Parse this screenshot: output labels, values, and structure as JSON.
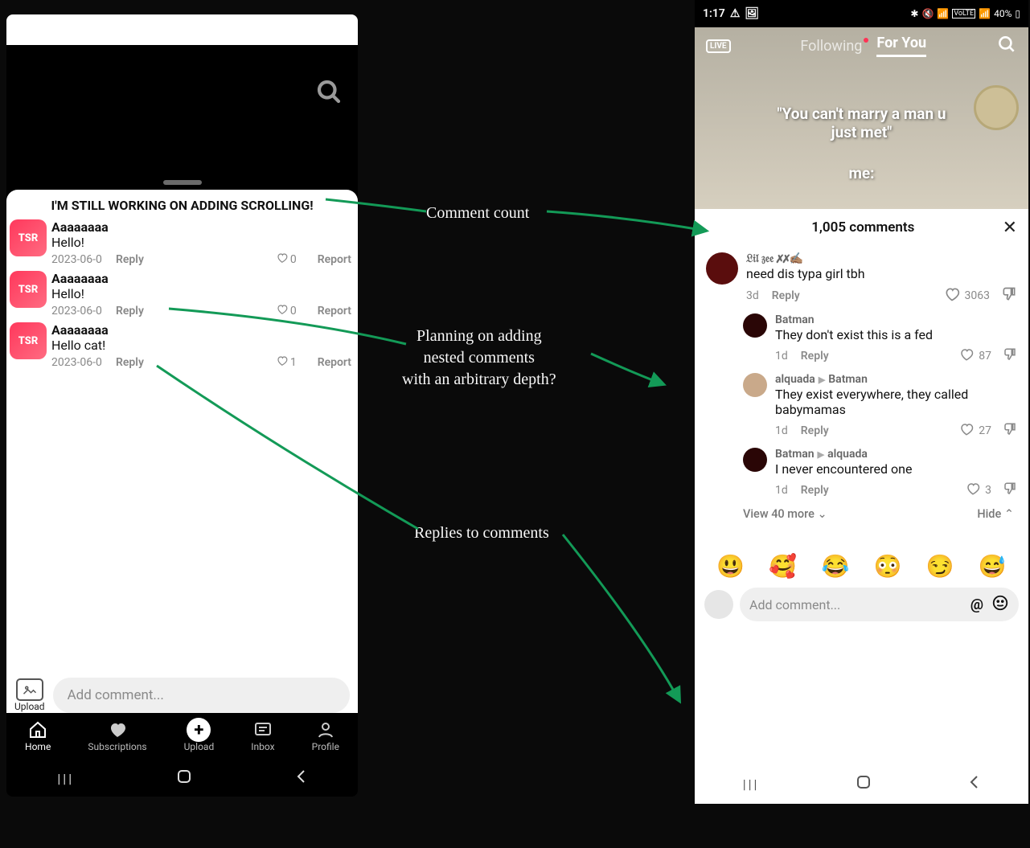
{
  "left": {
    "sheet_title": "I'M STILL WORKING ON ADDING SCROLLING!",
    "avatar_badge": "TSR",
    "comments": [
      {
        "user": "Aaaaaaaa",
        "text": "Hello!",
        "date": "2023-06-0",
        "reply": "Reply",
        "likes": "0",
        "report": "Report"
      },
      {
        "user": "Aaaaaaaa",
        "text": "Hello!",
        "date": "2023-06-0",
        "reply": "Reply",
        "likes": "0",
        "report": "Report"
      },
      {
        "user": "Aaaaaaaa",
        "text": "Hello cat!",
        "date": "2023-06-0",
        "reply": "Reply",
        "likes": "1",
        "report": "Report"
      }
    ],
    "upload_label": "Upload",
    "add_comment_placeholder": "Add comment...",
    "nav": {
      "home": "Home",
      "subs": "Subscriptions",
      "upload": "Upload",
      "inbox": "Inbox",
      "profile": "Profile"
    }
  },
  "right": {
    "status": {
      "time": "1:17",
      "battery": "40%",
      "vol_lte": "VoLTE"
    },
    "tabs": {
      "following": "Following",
      "for_you": "For You"
    },
    "caption_line1": "\"You can't marry a man u",
    "caption_line2": "just met\"",
    "caption_line3": "me:",
    "comments_header": "1,005 comments",
    "comments": [
      {
        "user": "𝔏𝔦𝔩 𝔷𝔢𝔢 ✗✗✍🏽",
        "text": "need dis typa girl tbh",
        "time": "3d",
        "reply": "Reply",
        "likes": "3063",
        "avatar": "#5a0d0d"
      },
      {
        "nested": true,
        "user": "Batman",
        "text": "They don't exist this is a fed",
        "time": "1d",
        "reply": "Reply",
        "likes": "87",
        "avatar": "#2a0606"
      },
      {
        "nested": true,
        "user": "alquada",
        "to": "Batman",
        "text": "They exist everywhere, they called babymamas",
        "time": "1d",
        "reply": "Reply",
        "likes": "27",
        "avatar": "#c9a98a"
      },
      {
        "nested": true,
        "user": "Batman",
        "to": "alquada",
        "text": "I never encountered one",
        "time": "1d",
        "reply": "Reply",
        "likes": "3",
        "avatar": "#2a0606"
      }
    ],
    "view_more": "View 40 more",
    "hide": "Hide",
    "emojis": [
      "😃",
      "🥰",
      "😂",
      "😳",
      "😏",
      "😅"
    ],
    "add_comment_placeholder": "Add comment..."
  },
  "annotations": {
    "a1": "Comment count",
    "a2": "Planning on adding\nnested comments\nwith an arbitrary depth?",
    "a3": "Replies to comments"
  }
}
